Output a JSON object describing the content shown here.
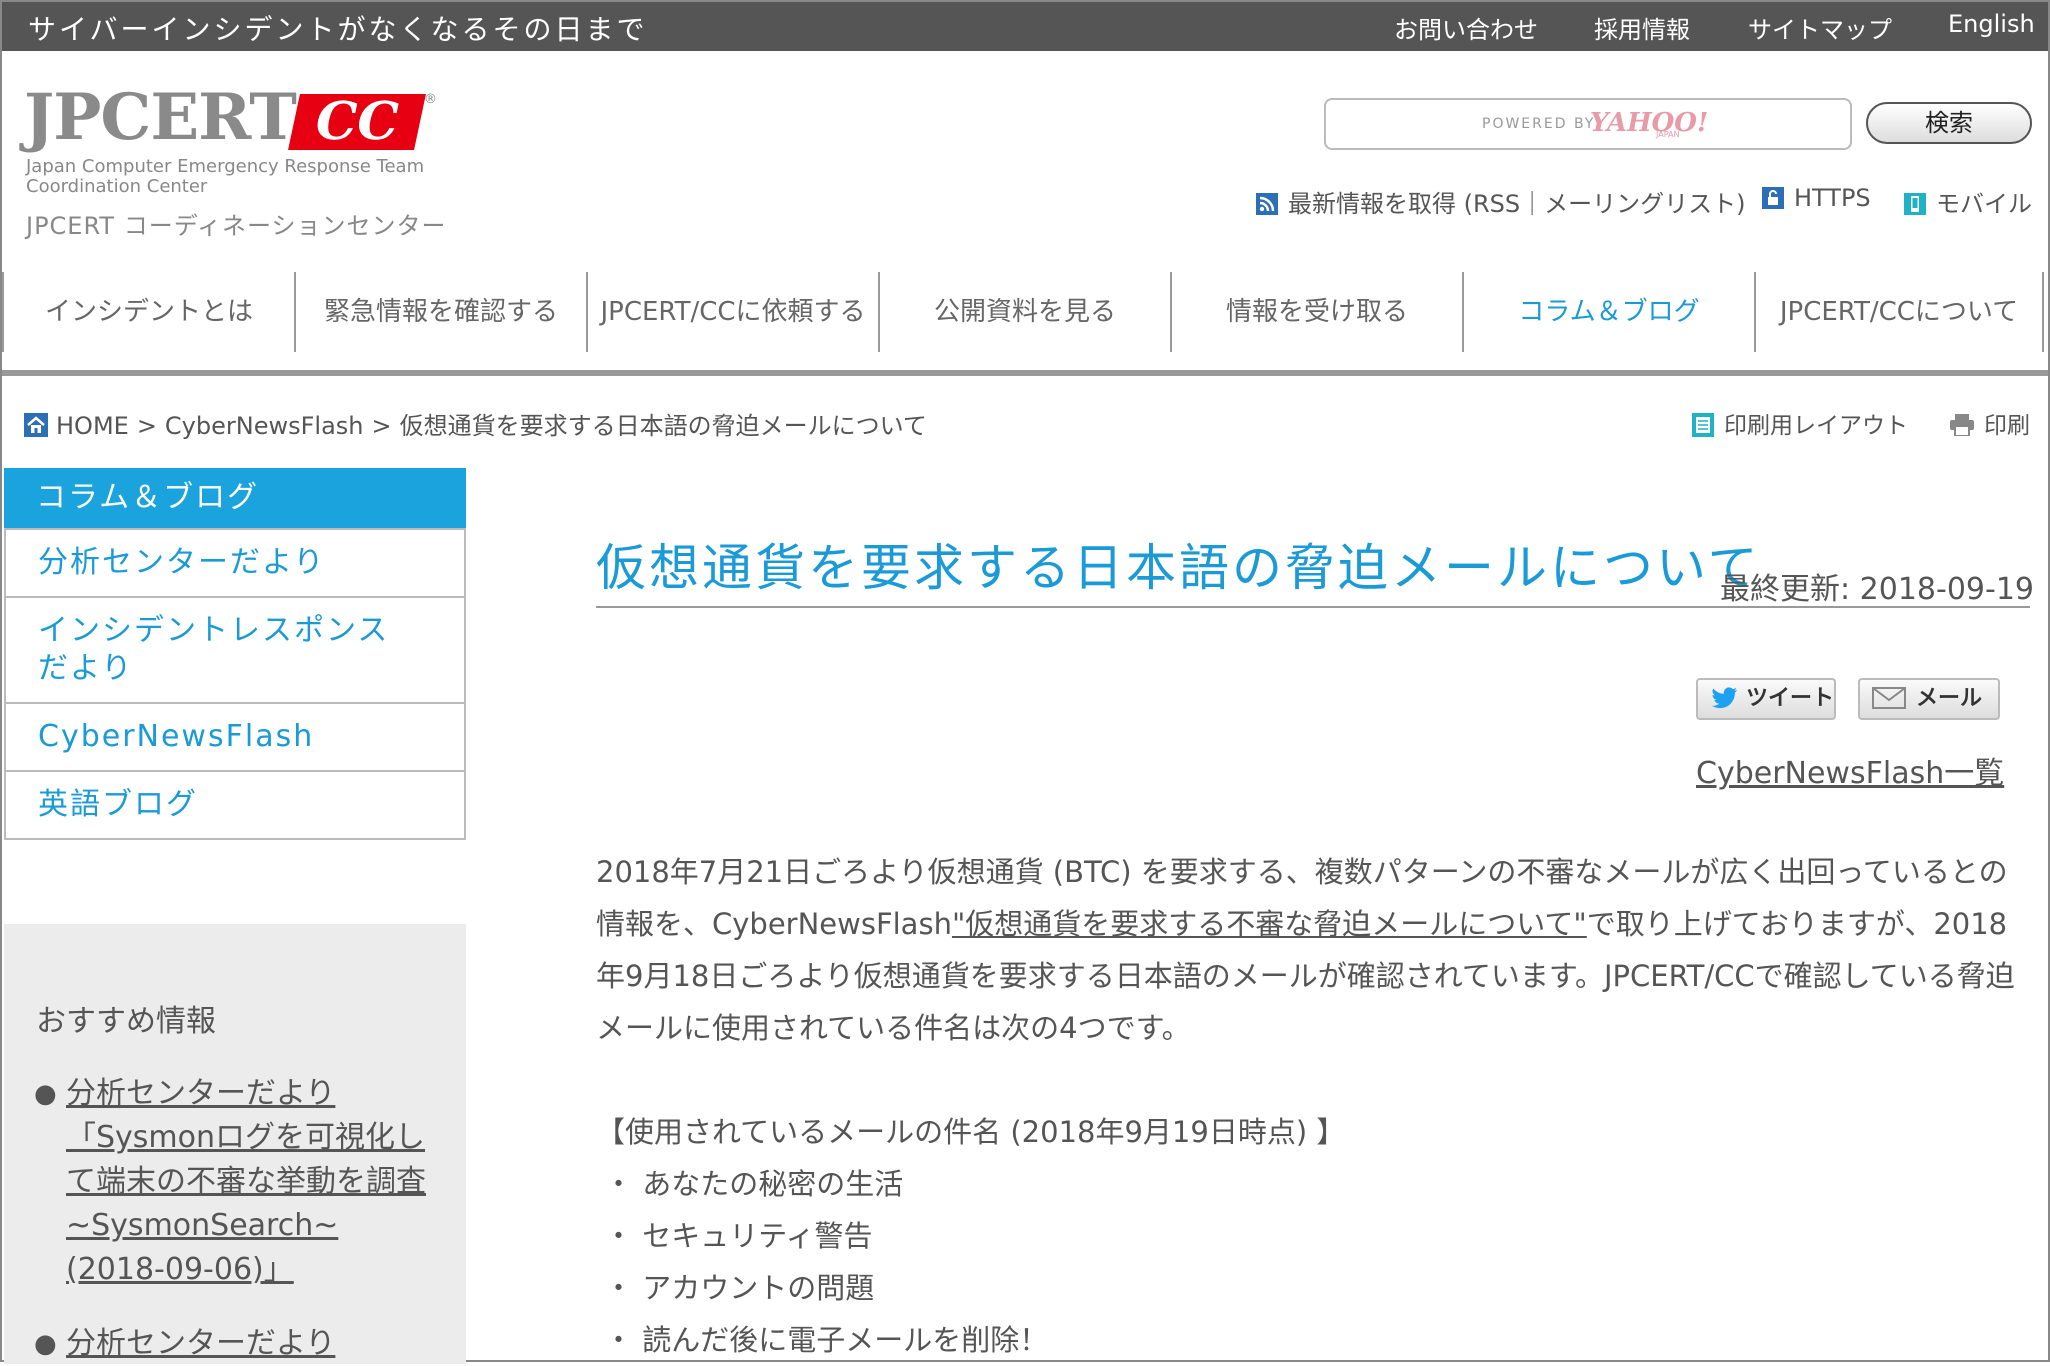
{
  "topbar": {
    "tagline": "サイバーインシデントがなくなるその日まで",
    "links": [
      "お問い合わせ",
      "採用情報",
      "サイトマップ",
      "English"
    ]
  },
  "logo": {
    "jpcert": "JPCERT",
    "cc": "CC",
    "reg": "®",
    "sub_line1": "Japan Computer Emergency Response Team",
    "sub_line2": "Coordination Center",
    "ja": "JPCERT コーディネーションセンター"
  },
  "search": {
    "powered_by": "POWERED BY",
    "yahoo": "YAHOO!",
    "japan": "JAPAN",
    "button": "検索"
  },
  "utility": {
    "rss": "最新情報を取得 (RSS｜メーリングリスト)",
    "https": "HTTPS",
    "mobile": "モバイル"
  },
  "gnav": [
    "インシデントとは",
    "緊急情報を確認する",
    "JPCERT/CCに依頼する",
    "公開資料を見る",
    "情報を受け取る",
    "コラム＆ブログ",
    "JPCERT/CCについて"
  ],
  "breadcrumb": {
    "home": "HOME",
    "sep": ">",
    "level1": "CyberNewsFlash",
    "current": "仮想通貨を要求する日本語の脅迫メールについて"
  },
  "print": {
    "layout": "印刷用レイアウト",
    "print": "印刷"
  },
  "sidebar": {
    "header": "コラム＆ブログ",
    "items": [
      "分析センターだより",
      "インシデントレスポンスだより",
      "CyberNewsFlash",
      "英語ブログ"
    ],
    "recommend_title": "おすすめ情報",
    "recommend": [
      "分析センターだより「Sysmonログを可視化して端末の不審な挙動を調査~SysmonSearch~(2018-09-06)」",
      "分析センターだより"
    ]
  },
  "article": {
    "title": "仮想通貨を要求する日本語の脅迫メールについて",
    "updated": "最終更新: 2018-09-19",
    "tweet": "ツイート",
    "mail": "メール",
    "list_link": "CyberNewsFlash一覧",
    "body_part1": "2018年7月21日ごろより仮想通貨 (BTC) を要求する、複数パターンの不審なメールが広く出回っているとの情報を、CyberNewsFlash",
    "body_link": "\"仮想通貨を要求する不審な脅迫メールについて\"",
    "body_part2": "で取り上げておりますが、2018年9月18日ごろより仮想通貨を要求する日本語のメールが確認されています。JPCERT/CCで確認している脅迫メールに使用されている件名は次の4つです。",
    "subjects_heading": "【使用されているメールの件名 (2018年9月19日時点) 】",
    "subjects": [
      "あなたの秘密の生活",
      "セキュリティ警告",
      "アカウントの問題",
      "読んだ後に電子メールを削除！"
    ],
    "bullet": "・"
  },
  "colors": {
    "accent": "#1aa3dc",
    "topbar": "#555555",
    "logo_red": "#e60012"
  }
}
